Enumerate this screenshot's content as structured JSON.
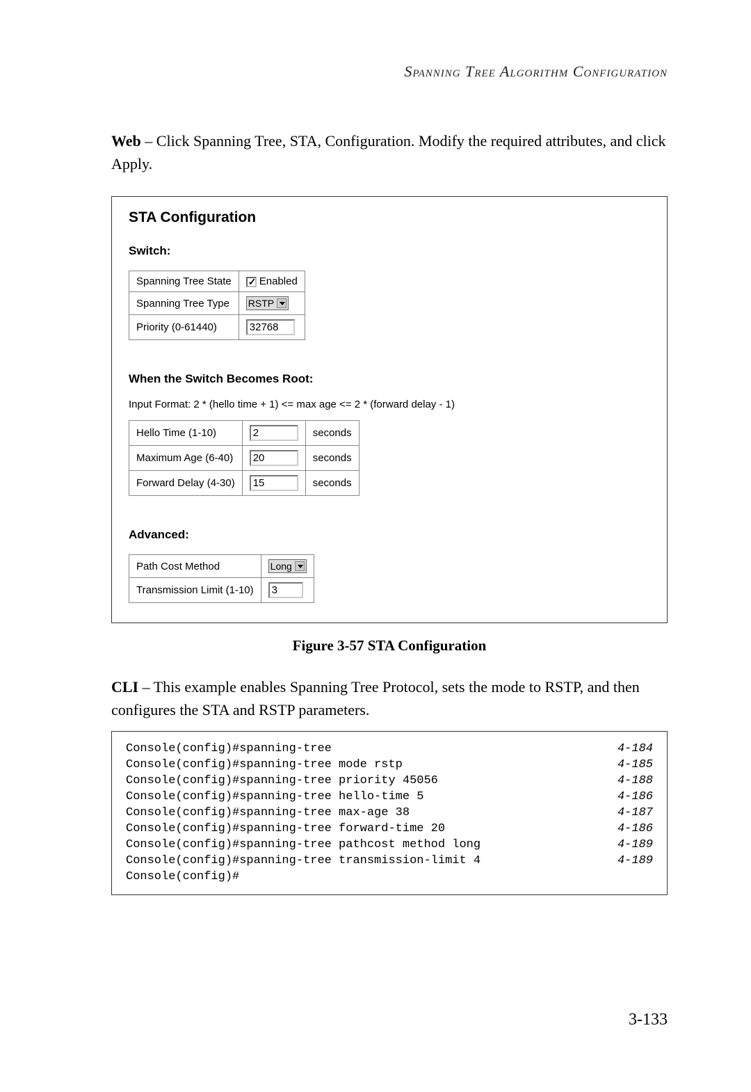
{
  "header": "Spanning Tree Algorithm Configuration",
  "intro": {
    "label": "Web",
    "text": " – Click Spanning Tree, STA, Configuration. Modify the required attributes, and click Apply."
  },
  "sta": {
    "title": "STA Configuration",
    "switch_heading": "Switch:",
    "switch_rows": {
      "state_label": "Spanning Tree State",
      "state_checkbox_label": "Enabled",
      "state_checked": true,
      "type_label": "Spanning Tree Type",
      "type_value": "RSTP",
      "priority_label": "Priority (0-61440)",
      "priority_value": "32768"
    },
    "root_heading": "When the Switch Becomes Root:",
    "root_formula": "Input Format: 2 * (hello time + 1) <= max age <= 2 * (forward delay - 1)",
    "root_rows": {
      "hello_label": "Hello Time (1-10)",
      "hello_value": "2",
      "maxage_label": "Maximum Age (6-40)",
      "maxage_value": "20",
      "forward_label": "Forward Delay (4-30)",
      "forward_value": "15",
      "unit": "seconds"
    },
    "advanced_heading": "Advanced:",
    "advanced_rows": {
      "pathcost_label": "Path Cost Method",
      "pathcost_value": "Long",
      "txlimit_label": "Transmission Limit (1-10)",
      "txlimit_value": "3"
    }
  },
  "figure_caption": "Figure 3-57  STA Configuration",
  "cli_intro": {
    "label": "CLI",
    "text": " – This example enables Spanning Tree Protocol, sets the mode to RSTP, and then configures the STA and RSTP parameters."
  },
  "cli_lines": [
    {
      "cmd": "Console(config)#spanning-tree",
      "ref": "4-184"
    },
    {
      "cmd": "Console(config)#spanning-tree mode rstp",
      "ref": "4-185"
    },
    {
      "cmd": "Console(config)#spanning-tree priority 45056",
      "ref": "4-188"
    },
    {
      "cmd": "Console(config)#spanning-tree hello-time 5",
      "ref": "4-186"
    },
    {
      "cmd": "Console(config)#spanning-tree max-age 38",
      "ref": "4-187"
    },
    {
      "cmd": "Console(config)#spanning-tree forward-time 20",
      "ref": "4-186"
    },
    {
      "cmd": "Console(config)#spanning-tree pathcost method long",
      "ref": "4-189"
    },
    {
      "cmd": "Console(config)#spanning-tree transmission-limit 4",
      "ref": "4-189"
    },
    {
      "cmd": "Console(config)#",
      "ref": ""
    }
  ],
  "page_number": "3-133"
}
